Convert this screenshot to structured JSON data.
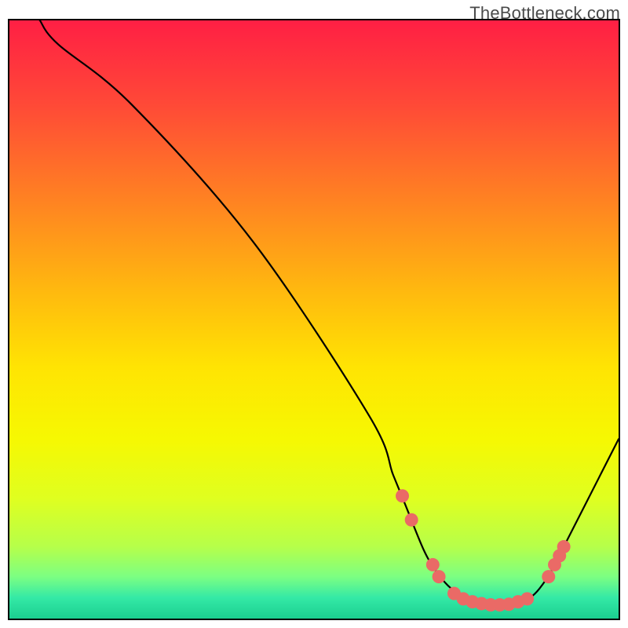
{
  "watermark": "TheBottleneck.com",
  "chart_data": {
    "type": "line",
    "title": "",
    "xlabel": "",
    "ylabel": "",
    "xlim": [
      0,
      100
    ],
    "ylim": [
      0,
      100
    ],
    "series": [
      {
        "name": "bottleneck-curve",
        "x": [
          5,
          8,
          20,
          40,
          59,
          63,
          65,
          68,
          70,
          72,
          74,
          76,
          78,
          80,
          82,
          84,
          85.5,
          87,
          89,
          91,
          95,
          100
        ],
        "y": [
          100,
          96,
          86,
          63,
          34,
          24,
          19,
          11.5,
          8,
          5.5,
          4,
          3,
          2.5,
          2.3,
          2.3,
          2.7,
          3.5,
          5,
          8,
          12,
          20,
          30
        ]
      }
    ],
    "markers": {
      "name": "highlighted-dots",
      "color": "#ea6a66",
      "points": [
        {
          "x": 64.5,
          "y": 20.5
        },
        {
          "x": 66.0,
          "y": 16.5
        },
        {
          "x": 69.5,
          "y": 9.0
        },
        {
          "x": 70.5,
          "y": 7.0
        },
        {
          "x": 73.0,
          "y": 4.2
        },
        {
          "x": 74.5,
          "y": 3.3
        },
        {
          "x": 76.0,
          "y": 2.8
        },
        {
          "x": 77.5,
          "y": 2.5
        },
        {
          "x": 79.0,
          "y": 2.3
        },
        {
          "x": 80.5,
          "y": 2.3
        },
        {
          "x": 82.0,
          "y": 2.4
        },
        {
          "x": 83.5,
          "y": 2.8
        },
        {
          "x": 85.0,
          "y": 3.3
        },
        {
          "x": 88.5,
          "y": 7.0
        },
        {
          "x": 89.5,
          "y": 9.0
        },
        {
          "x": 90.3,
          "y": 10.5
        },
        {
          "x": 91.0,
          "y": 12.0
        }
      ]
    },
    "gradient": {
      "name": "traffic-light-vertical",
      "stops": [
        {
          "offset": 0.0,
          "color": "#ff1f44"
        },
        {
          "offset": 0.14,
          "color": "#ff4937"
        },
        {
          "offset": 0.3,
          "color": "#ff8222"
        },
        {
          "offset": 0.45,
          "color": "#ffb80f"
        },
        {
          "offset": 0.58,
          "color": "#ffe403"
        },
        {
          "offset": 0.7,
          "color": "#f6f802"
        },
        {
          "offset": 0.8,
          "color": "#dfff20"
        },
        {
          "offset": 0.88,
          "color": "#b6ff4a"
        },
        {
          "offset": 0.93,
          "color": "#7cff82"
        },
        {
          "offset": 0.965,
          "color": "#34e9a6"
        },
        {
          "offset": 1.0,
          "color": "#1bcf90"
        }
      ]
    }
  }
}
